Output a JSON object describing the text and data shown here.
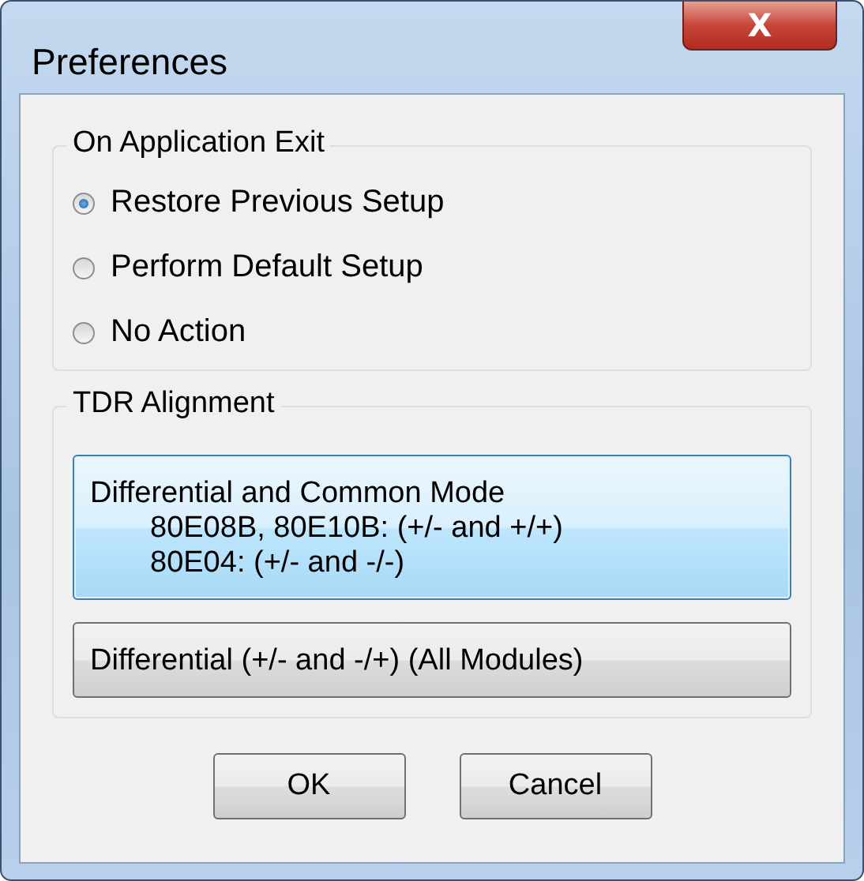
{
  "window": {
    "title": "Preferences",
    "close_label": "X"
  },
  "exit_group": {
    "title": "On Application Exit",
    "options": [
      {
        "label": "Restore Previous Setup",
        "selected": true
      },
      {
        "label": "Perform Default Setup",
        "selected": false
      },
      {
        "label": "No Action",
        "selected": false
      }
    ]
  },
  "tdr_group": {
    "title": "TDR Alignment",
    "options": [
      {
        "lines": [
          "Differential and Common Mode",
          "80E08B, 80E10B: (+/- and +/+)",
          "80E04: (+/- and -/-)"
        ],
        "selected": true
      },
      {
        "lines": [
          "Differential (+/- and -/+) (All Modules)"
        ],
        "selected": false
      }
    ]
  },
  "buttons": [
    "OK",
    "Cancel"
  ]
}
